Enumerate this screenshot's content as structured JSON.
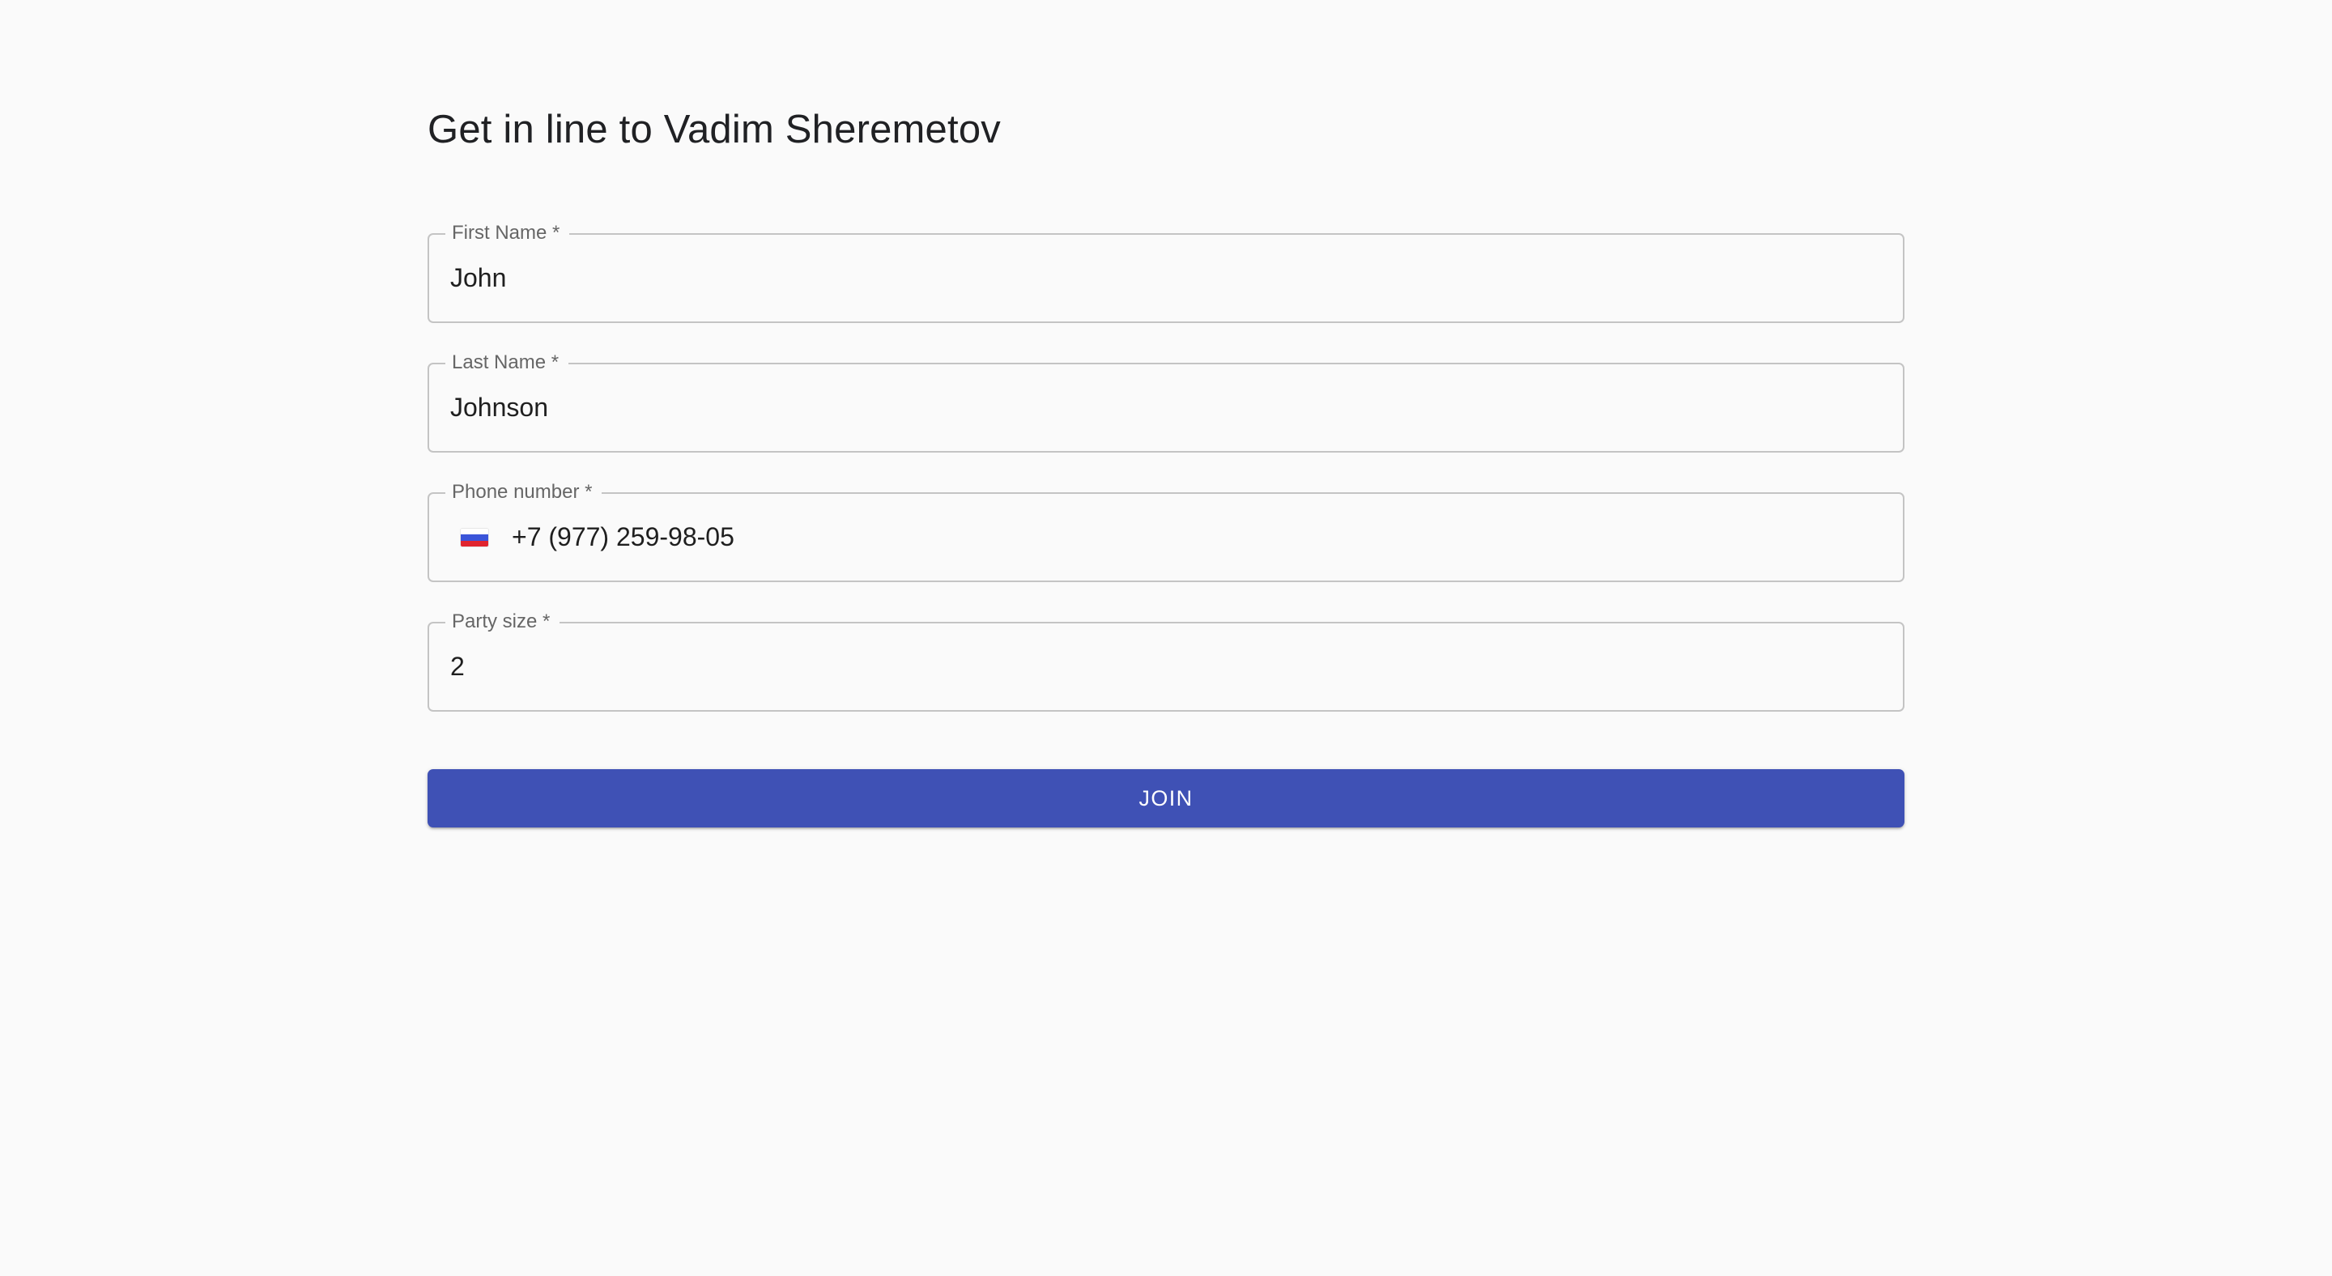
{
  "page": {
    "title": "Get in line to Vadim Sheremetov"
  },
  "form": {
    "first_name": {
      "label": "First Name *",
      "value": "John"
    },
    "last_name": {
      "label": "Last Name *",
      "value": "Johnson"
    },
    "phone": {
      "label": "Phone number *",
      "value": "+7 (977) 259-98-05",
      "country_flag_icon": "russia-flag-icon"
    },
    "party_size": {
      "label": "Party size *",
      "value": "2"
    },
    "submit_label": "Join"
  },
  "colors": {
    "background": "#fafafa",
    "accent": "#3f51b5",
    "field_border": "#c4c4c4",
    "label": "#666666"
  }
}
